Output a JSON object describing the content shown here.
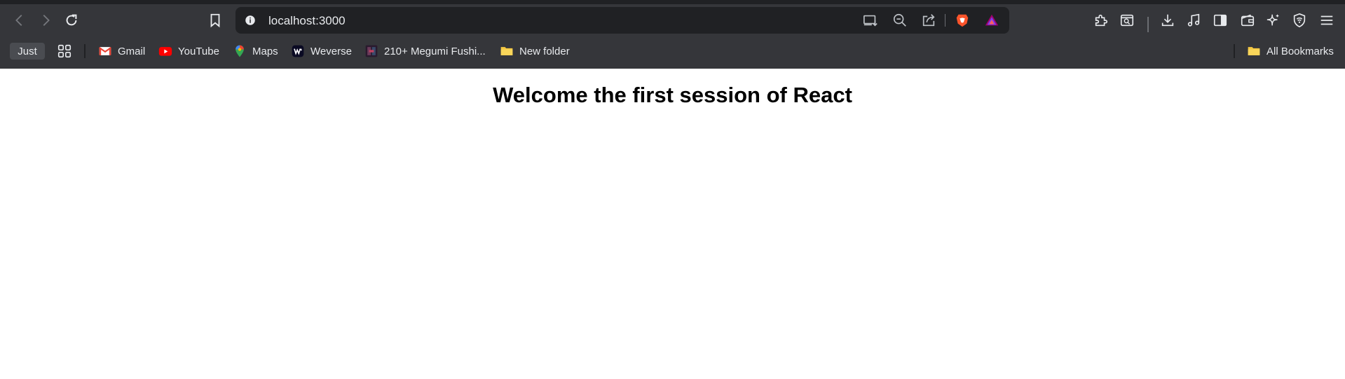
{
  "browser": {
    "address_bar": {
      "url": "localhost:3000"
    },
    "bookmarks_bar": {
      "chip_label": "Just",
      "items": [
        {
          "label": "Gmail",
          "icon": "gmail-icon"
        },
        {
          "label": "YouTube",
          "icon": "youtube-icon"
        },
        {
          "label": "Maps",
          "icon": "maps-icon"
        },
        {
          "label": "Weverse",
          "icon": "weverse-icon"
        },
        {
          "label": "210+ Megumi Fushi...",
          "icon": "site-favicon-icon"
        },
        {
          "label": "New folder",
          "icon": "folder-icon"
        }
      ],
      "all_bookmarks_label": "All Bookmarks"
    },
    "colors": {
      "chrome_bg": "#35363a",
      "omnibox_bg": "#202124",
      "text": "#e8eaed",
      "brave_orange": "#fb542b",
      "youtube_red": "#ff0000",
      "folder_yellow": "#f5c842"
    }
  },
  "page": {
    "heading": "Welcome the first session of React"
  }
}
